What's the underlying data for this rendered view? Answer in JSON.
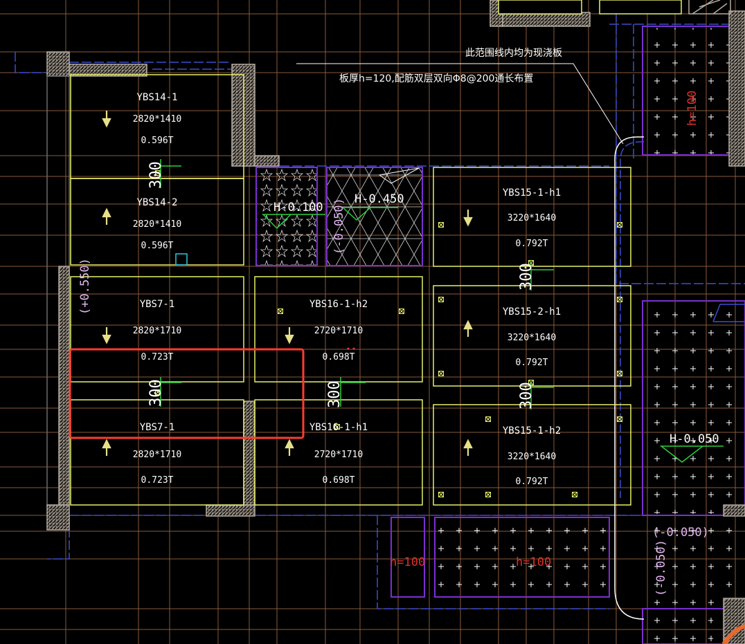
{
  "viewport": {
    "background": "#000000"
  },
  "colors": {
    "grid": "#8a5a3c",
    "slab_outline": "#e8f06a",
    "wall_hatch": "#b5aca0",
    "beam_blue": "#3a4fd0",
    "purple": "#7b2fd0",
    "arrow": "#e6e08a",
    "dim_green": "#2ccf3c",
    "highlight": "#ff3b30",
    "label_red": "#e0302a"
  },
  "note": {
    "line1": "此范围线内均为现浇板",
    "line2": "板厚h=120,配筋双层双向Φ8@200通长布置"
  },
  "slabs": [
    {
      "id": "slab-ybs14-1",
      "name": "YBS14-1",
      "size": "2820*1410",
      "weight": "0.596T",
      "arrow": "down"
    },
    {
      "id": "slab-ybs14-2",
      "name": "YBS14-2",
      "size": "2820*1410",
      "weight": "0.596T",
      "arrow": "up"
    },
    {
      "id": "slab-ybs7-1-top",
      "name": "YBS7-1",
      "size": "2820*1710",
      "weight": "0.723T",
      "arrow": "down"
    },
    {
      "id": "slab-ybs7-1-bottom",
      "name": "YBS7-1",
      "size": "2820*1710",
      "weight": "0.723T",
      "arrow": "up"
    },
    {
      "id": "slab-ybs16-1-h2",
      "name": "YBS16-1-h2",
      "size": "2720*1710",
      "weight": "0.698T",
      "arrow": "down"
    },
    {
      "id": "slab-ybs16-1-h1",
      "name": "YBS16-1-h1",
      "size": "2720*1710",
      "weight": "0.698T",
      "arrow": "up"
    },
    {
      "id": "slab-ybs15-1-h1",
      "name": "YBS15-1-h1",
      "size": "3220*1640",
      "weight": "0.792T",
      "arrow": "down"
    },
    {
      "id": "slab-ybs15-2-h1",
      "name": "YBS15-2-h1",
      "size": "3220*1640",
      "weight": "0.792T",
      "arrow": "up"
    },
    {
      "id": "slab-ybs15-1-h2",
      "name": "YBS15-1-h2",
      "size": "3220*1640",
      "weight": "0.792T",
      "arrow": "up"
    }
  ],
  "joints": [
    "300",
    "300",
    "300",
    "300",
    "300"
  ],
  "elevations": {
    "wet1": "H-0.100",
    "wet2": "H-0.450",
    "wet2_paren": "(-0.050)",
    "left_paren": "(+0.550)",
    "right": "H-0.050",
    "right_paren": "(-0.050)",
    "right_vertical": "(-0.050)"
  },
  "thickness": {
    "top_right": "h=100",
    "bottom_left": "h=100",
    "bottom_mid": "h=100"
  }
}
